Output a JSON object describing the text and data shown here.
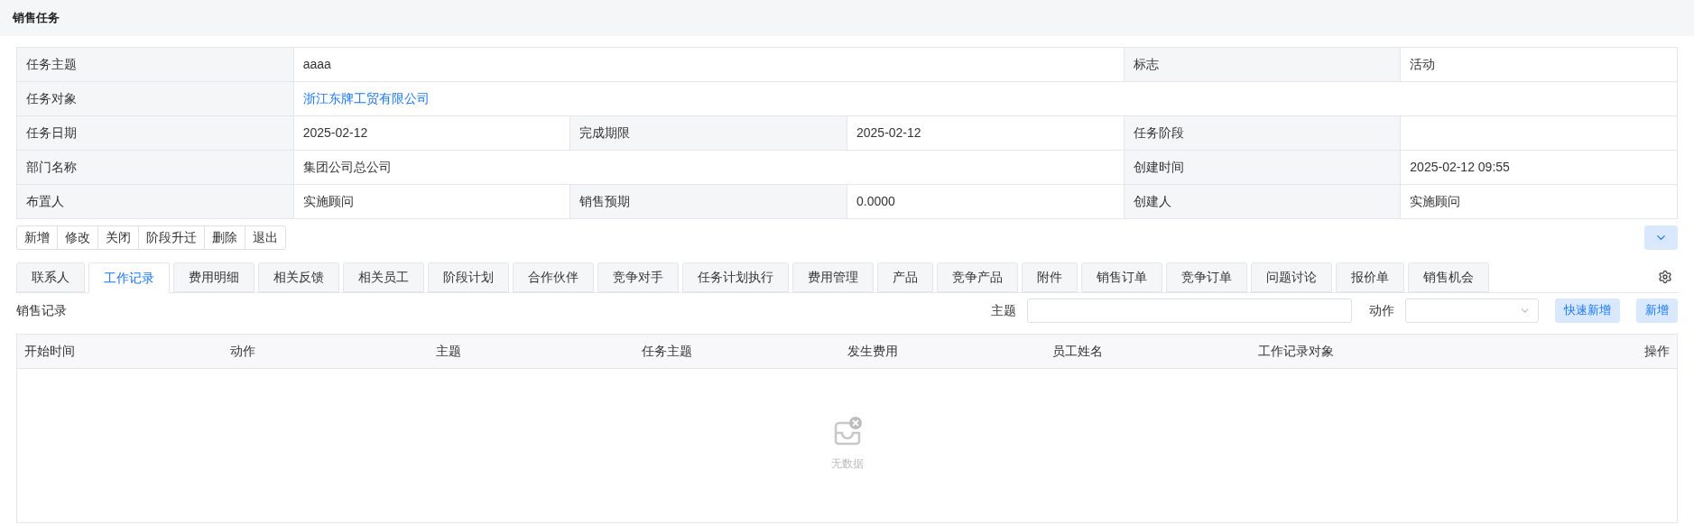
{
  "page_title": "销售任务",
  "info_rows": [
    {
      "cells": [
        {
          "kind": "label",
          "text": "任务主题"
        },
        {
          "kind": "value",
          "text": "aaaa"
        },
        {
          "kind": "label",
          "text": "标志"
        },
        {
          "kind": "value",
          "text": "活动"
        }
      ]
    },
    {
      "cells": [
        {
          "kind": "label",
          "text": "任务对象"
        },
        {
          "kind": "link",
          "text": "浙江东牌工贸有限公司"
        }
      ]
    },
    {
      "cells": [
        {
          "kind": "label",
          "text": "任务日期"
        },
        {
          "kind": "value",
          "text": "2025-02-12"
        },
        {
          "kind": "label",
          "text": "完成期限"
        },
        {
          "kind": "value",
          "text": "2025-02-12"
        },
        {
          "kind": "label",
          "text": "任务阶段"
        },
        {
          "kind": "value"
        }
      ]
    },
    {
      "cells": [
        {
          "kind": "label",
          "text": "部门名称"
        },
        {
          "kind": "value",
          "text": "集团公司总公司"
        },
        {
          "kind": "label",
          "text": "创建时间"
        },
        {
          "kind": "value",
          "text": "2025-02-12 09:55"
        }
      ]
    },
    {
      "cells": [
        {
          "kind": "label",
          "text": "布置人"
        },
        {
          "kind": "value",
          "text": "实施顾问"
        },
        {
          "kind": "label",
          "text": "销售预期"
        },
        {
          "kind": "value",
          "text": "0.0000"
        },
        {
          "kind": "label",
          "text": "创建人"
        },
        {
          "kind": "value",
          "text": "实施顾问"
        }
      ]
    }
  ],
  "toolbar": [
    "新增",
    "修改",
    "关闭",
    "阶段升迁",
    "删除",
    "退出"
  ],
  "tabs": [
    {
      "label": "联系人",
      "selected": false
    },
    {
      "label": "工作记录",
      "selected": true
    },
    {
      "label": "费用明细",
      "selected": false
    },
    {
      "label": "相关反馈",
      "selected": false
    },
    {
      "label": "相关员工",
      "selected": false
    },
    {
      "label": "阶段计划",
      "selected": false
    },
    {
      "label": "合作伙伴",
      "selected": false
    },
    {
      "label": "竞争对手",
      "selected": false
    },
    {
      "label": "任务计划执行",
      "selected": false
    },
    {
      "label": "费用管理",
      "selected": false
    },
    {
      "label": "产品",
      "selected": false
    },
    {
      "label": "竞争产品",
      "selected": false
    },
    {
      "label": "附件",
      "selected": false
    },
    {
      "label": "销售订单",
      "selected": false
    },
    {
      "label": "竞争订单",
      "selected": false
    },
    {
      "label": "问题讨论",
      "selected": false
    },
    {
      "label": "报价单",
      "selected": false
    },
    {
      "label": "销售机会",
      "selected": false
    }
  ],
  "section_title": "销售记录",
  "filters": {
    "subject_label": "主题",
    "action_label": "动作"
  },
  "actions": [
    "快速新增",
    "新增"
  ],
  "table": {
    "columns": [
      "开始时间",
      "动作",
      "主题",
      "任务主题",
      "发生费用",
      "员工姓名",
      "工作记录对象",
      "操作"
    ],
    "empty_text": "无数据"
  }
}
